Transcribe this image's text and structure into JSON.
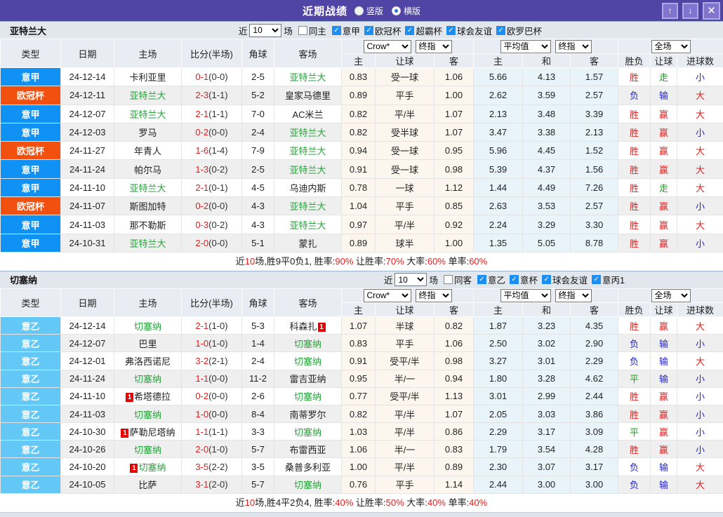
{
  "titlebar": {
    "title": "近期战绩",
    "radios": [
      {
        "label": "竖版",
        "selected": false
      },
      {
        "label": "横版",
        "selected": true
      }
    ]
  },
  "icons": {
    "up": "↑",
    "down": "↓",
    "close": "✕",
    "check": "✓"
  },
  "colors": {
    "type": {
      "意甲": "#0f92f4",
      "欧冠杯": "#f1500e",
      "意乙": "#63c8f6"
    },
    "result": {
      "胜": "#e02020",
      "负": "#2424cc",
      "平": "#1fa01f",
      "赢": "#e02020",
      "输": "#2424cc",
      "走": "#1fa01f",
      "大": "#e02020",
      "小": "#2424cc"
    },
    "team_green": "#28a33c",
    "score_red": "#e02020",
    "badge_red": "#e80000",
    "titlebar_purple": "#5044a4"
  },
  "table_header": {
    "cols": [
      "类型",
      "日期",
      "主场",
      "比分(半场)",
      "角球",
      "客场"
    ],
    "bookmaker_select": "Crow*",
    "bookmaker_stage_select": "终指",
    "odds_cols": [
      "主",
      "让球",
      "客"
    ],
    "average_select": "平均值",
    "average_stage_select": "终指",
    "avg_cols": [
      "主",
      "和",
      "客"
    ],
    "scope_select": "全场",
    "result_cols": [
      "胜负",
      "让球",
      "进球数"
    ]
  },
  "sections": [
    {
      "team": "亚特兰大",
      "filter": {
        "prefix": "近",
        "count": "10",
        "suffix": "场",
        "same": {
          "label": "同主",
          "checked": false
        },
        "leagues": [
          {
            "label": "意甲",
            "checked": true
          },
          {
            "label": "欧冠杯",
            "checked": true
          },
          {
            "label": "超霸杯",
            "checked": true
          },
          {
            "label": "球会友谊",
            "checked": true
          },
          {
            "label": "欧罗巴杯",
            "checked": true
          }
        ]
      },
      "rows": [
        {
          "type": "意甲",
          "date": "24-12-14",
          "home": {
            "name": "卡利亚里",
            "green": false
          },
          "score": {
            "ft": "0-1",
            "ht": "(0-0)"
          },
          "corner": "2-5",
          "away": {
            "name": "亚特兰大",
            "green": true
          },
          "odds": [
            "0.83",
            "受一球",
            "1.06"
          ],
          "avg": [
            "5.66",
            "4.13",
            "1.57"
          ],
          "results": [
            "胜",
            "走",
            "小"
          ]
        },
        {
          "type": "欧冠杯",
          "date": "24-12-11",
          "home": {
            "name": "亚特兰大",
            "green": true
          },
          "score": {
            "ft": "2-3",
            "ht": "(1-1)"
          },
          "corner": "5-2",
          "away": {
            "name": "皇家马德里",
            "green": false
          },
          "odds": [
            "0.89",
            "平手",
            "1.00"
          ],
          "avg": [
            "2.62",
            "3.59",
            "2.57"
          ],
          "results": [
            "负",
            "输",
            "大"
          ]
        },
        {
          "type": "意甲",
          "date": "24-12-07",
          "home": {
            "name": "亚特兰大",
            "green": true
          },
          "score": {
            "ft": "2-1",
            "ht": "(1-1)"
          },
          "corner": "7-0",
          "away": {
            "name": "AC米兰",
            "green": false
          },
          "odds": [
            "0.82",
            "平/半",
            "1.07"
          ],
          "avg": [
            "2.13",
            "3.48",
            "3.39"
          ],
          "results": [
            "胜",
            "赢",
            "大"
          ]
        },
        {
          "type": "意甲",
          "date": "24-12-03",
          "home": {
            "name": "罗马",
            "green": false
          },
          "score": {
            "ft": "0-2",
            "ht": "(0-0)"
          },
          "corner": "2-4",
          "away": {
            "name": "亚特兰大",
            "green": true
          },
          "odds": [
            "0.82",
            "受半球",
            "1.07"
          ],
          "avg": [
            "3.47",
            "3.38",
            "2.13"
          ],
          "results": [
            "胜",
            "赢",
            "小"
          ]
        },
        {
          "type": "欧冠杯",
          "date": "24-11-27",
          "home": {
            "name": "年青人",
            "green": false
          },
          "score": {
            "ft": "1-6",
            "ht": "(1-4)"
          },
          "corner": "7-9",
          "away": {
            "name": "亚特兰大",
            "green": true
          },
          "odds": [
            "0.94",
            "受一球",
            "0.95"
          ],
          "avg": [
            "5.96",
            "4.45",
            "1.52"
          ],
          "results": [
            "胜",
            "赢",
            "大"
          ]
        },
        {
          "type": "意甲",
          "date": "24-11-24",
          "home": {
            "name": "帕尔马",
            "green": false
          },
          "score": {
            "ft": "1-3",
            "ht": "(0-2)"
          },
          "corner": "2-5",
          "away": {
            "name": "亚特兰大",
            "green": true
          },
          "odds": [
            "0.91",
            "受一球",
            "0.98"
          ],
          "avg": [
            "5.39",
            "4.37",
            "1.56"
          ],
          "results": [
            "胜",
            "赢",
            "大"
          ]
        },
        {
          "type": "意甲",
          "date": "24-11-10",
          "home": {
            "name": "亚特兰大",
            "green": true
          },
          "score": {
            "ft": "2-1",
            "ht": "(0-1)"
          },
          "corner": "4-5",
          "away": {
            "name": "乌迪内斯",
            "green": false
          },
          "odds": [
            "0.78",
            "一球",
            "1.12"
          ],
          "avg": [
            "1.44",
            "4.49",
            "7.26"
          ],
          "results": [
            "胜",
            "走",
            "大"
          ]
        },
        {
          "type": "欧冠杯",
          "date": "24-11-07",
          "home": {
            "name": "斯图加特",
            "green": false
          },
          "score": {
            "ft": "0-2",
            "ht": "(0-0)"
          },
          "corner": "4-3",
          "away": {
            "name": "亚特兰大",
            "green": true
          },
          "odds": [
            "1.04",
            "平手",
            "0.85"
          ],
          "avg": [
            "2.63",
            "3.53",
            "2.57"
          ],
          "results": [
            "胜",
            "赢",
            "小"
          ]
        },
        {
          "type": "意甲",
          "date": "24-11-03",
          "home": {
            "name": "那不勒斯",
            "green": false
          },
          "score": {
            "ft": "0-3",
            "ht": "(0-2)"
          },
          "corner": "4-3",
          "away": {
            "name": "亚特兰大",
            "green": true
          },
          "odds": [
            "0.97",
            "平/半",
            "0.92"
          ],
          "avg": [
            "2.24",
            "3.29",
            "3.30"
          ],
          "results": [
            "胜",
            "赢",
            "大"
          ]
        },
        {
          "type": "意甲",
          "date": "24-10-31",
          "home": {
            "name": "亚特兰大",
            "green": true
          },
          "score": {
            "ft": "2-0",
            "ht": "(0-0)"
          },
          "corner": "5-1",
          "away": {
            "name": "蒙扎",
            "green": false
          },
          "odds": [
            "0.89",
            "球半",
            "1.00"
          ],
          "avg": [
            "1.35",
            "5.05",
            "8.78"
          ],
          "results": [
            "胜",
            "赢",
            "小"
          ]
        }
      ],
      "summary": [
        {
          "t": "近"
        },
        {
          "t": "10",
          "red": true
        },
        {
          "t": "场,胜9平0负1, 胜率:"
        },
        {
          "t": "90%",
          "red": true
        },
        {
          "t": " 让胜率:"
        },
        {
          "t": "70%",
          "red": true
        },
        {
          "t": " 大率:"
        },
        {
          "t": "60%",
          "red": true
        },
        {
          "t": " 单率:"
        },
        {
          "t": "60%",
          "red": true
        }
      ]
    },
    {
      "team": "切塞纳",
      "filter": {
        "prefix": "近",
        "count": "10",
        "suffix": "场",
        "same": {
          "label": "同客",
          "checked": false
        },
        "leagues": [
          {
            "label": "意乙",
            "checked": true
          },
          {
            "label": "意杯",
            "checked": true
          },
          {
            "label": "球会友谊",
            "checked": true
          },
          {
            "label": "意丙1",
            "checked": true
          }
        ]
      },
      "rows": [
        {
          "type": "意乙",
          "date": "24-12-14",
          "home": {
            "name": "切塞纳",
            "green": true
          },
          "score": {
            "ft": "2-1",
            "ht": "(1-0)"
          },
          "corner": "5-3",
          "away": {
            "name": "科森扎",
            "green": false,
            "badge": "1",
            "badge_side": "right"
          },
          "odds": [
            "1.07",
            "半球",
            "0.82"
          ],
          "avg": [
            "1.87",
            "3.23",
            "4.35"
          ],
          "results": [
            "胜",
            "赢",
            "大"
          ]
        },
        {
          "type": "意乙",
          "date": "24-12-07",
          "home": {
            "name": "巴里",
            "green": false
          },
          "score": {
            "ft": "1-0",
            "ht": "(1-0)"
          },
          "corner": "1-4",
          "away": {
            "name": "切塞纳",
            "green": true
          },
          "odds": [
            "0.83",
            "平手",
            "1.06"
          ],
          "avg": [
            "2.50",
            "3.02",
            "2.90"
          ],
          "results": [
            "负",
            "输",
            "小"
          ]
        },
        {
          "type": "意乙",
          "date": "24-12-01",
          "home": {
            "name": "弗洛西诺尼",
            "green": false
          },
          "score": {
            "ft": "3-2",
            "ht": "(2-1)"
          },
          "corner": "2-4",
          "away": {
            "name": "切塞纳",
            "green": true
          },
          "odds": [
            "0.91",
            "受平/半",
            "0.98"
          ],
          "avg": [
            "3.27",
            "3.01",
            "2.29"
          ],
          "results": [
            "负",
            "输",
            "大"
          ]
        },
        {
          "type": "意乙",
          "date": "24-11-24",
          "home": {
            "name": "切塞纳",
            "green": true
          },
          "score": {
            "ft": "1-1",
            "ht": "(0-0)"
          },
          "corner": "11-2",
          "away": {
            "name": "雷吉亚纳",
            "green": false
          },
          "odds": [
            "0.95",
            "半/一",
            "0.94"
          ],
          "avg": [
            "1.80",
            "3.28",
            "4.62"
          ],
          "results": [
            "平",
            "输",
            "小"
          ]
        },
        {
          "type": "意乙",
          "date": "24-11-10",
          "home": {
            "name": "希塔德拉",
            "green": false,
            "badge": "1",
            "badge_side": "left"
          },
          "score": {
            "ft": "0-2",
            "ht": "(0-0)"
          },
          "corner": "2-6",
          "away": {
            "name": "切塞纳",
            "green": true
          },
          "odds": [
            "0.77",
            "受平/半",
            "1.13"
          ],
          "avg": [
            "3.01",
            "2.99",
            "2.44"
          ],
          "results": [
            "胜",
            "赢",
            "小"
          ]
        },
        {
          "type": "意乙",
          "date": "24-11-03",
          "home": {
            "name": "切塞纳",
            "green": true
          },
          "score": {
            "ft": "1-0",
            "ht": "(0-0)"
          },
          "corner": "8-4",
          "away": {
            "name": "南蒂罗尔",
            "green": false
          },
          "odds": [
            "0.82",
            "平/半",
            "1.07"
          ],
          "avg": [
            "2.05",
            "3.03",
            "3.86"
          ],
          "results": [
            "胜",
            "赢",
            "小"
          ]
        },
        {
          "type": "意乙",
          "date": "24-10-30",
          "home": {
            "name": "萨勒尼塔纳",
            "green": false,
            "badge": "1",
            "badge_side": "left"
          },
          "score": {
            "ft": "1-1",
            "ht": "(1-1)"
          },
          "corner": "3-3",
          "away": {
            "name": "切塞纳",
            "green": true
          },
          "odds": [
            "1.03",
            "平/半",
            "0.86"
          ],
          "avg": [
            "2.29",
            "3.17",
            "3.09"
          ],
          "results": [
            "平",
            "赢",
            "小"
          ]
        },
        {
          "type": "意乙",
          "date": "24-10-26",
          "home": {
            "name": "切塞纳",
            "green": true
          },
          "score": {
            "ft": "2-0",
            "ht": "(1-0)"
          },
          "corner": "5-7",
          "away": {
            "name": "布雷西亚",
            "green": false
          },
          "odds": [
            "1.06",
            "半/一",
            "0.83"
          ],
          "avg": [
            "1.79",
            "3.54",
            "4.28"
          ],
          "results": [
            "胜",
            "赢",
            "小"
          ]
        },
        {
          "type": "意乙",
          "date": "24-10-20",
          "home": {
            "name": "切塞纳",
            "green": true,
            "badge": "1",
            "badge_side": "left"
          },
          "score": {
            "ft": "3-5",
            "ht": "(2-2)"
          },
          "corner": "3-5",
          "away": {
            "name": "桑普多利亚",
            "green": false
          },
          "odds": [
            "1.00",
            "平/半",
            "0.89"
          ],
          "avg": [
            "2.30",
            "3.07",
            "3.17"
          ],
          "results": [
            "负",
            "输",
            "大"
          ]
        },
        {
          "type": "意乙",
          "date": "24-10-05",
          "home": {
            "name": "比萨",
            "green": false
          },
          "score": {
            "ft": "3-1",
            "ht": "(2-0)"
          },
          "corner": "5-7",
          "away": {
            "name": "切塞纳",
            "green": true
          },
          "odds": [
            "0.76",
            "平手",
            "1.14"
          ],
          "avg": [
            "2.44",
            "3.00",
            "3.00"
          ],
          "results": [
            "负",
            "输",
            "大"
          ]
        }
      ],
      "summary": [
        {
          "t": "近"
        },
        {
          "t": "10",
          "red": true
        },
        {
          "t": "场,胜4平2负4, 胜率:"
        },
        {
          "t": "40%",
          "red": true
        },
        {
          "t": " 让胜率:"
        },
        {
          "t": "50%",
          "red": true
        },
        {
          "t": " 大率:"
        },
        {
          "t": "40%",
          "red": true
        },
        {
          "t": " 单率:"
        },
        {
          "t": "40%",
          "red": true
        }
      ]
    }
  ]
}
